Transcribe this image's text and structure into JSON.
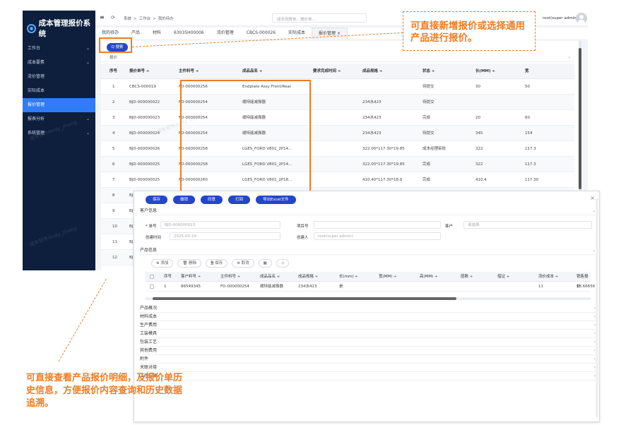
{
  "app": {
    "title": "成本管理报价系统"
  },
  "sidebar": {
    "items": [
      {
        "label": "工作台",
        "has_children": true
      },
      {
        "label": "成本要素",
        "has_children": true
      },
      {
        "label": "流价管理",
        "has_children": false
      },
      {
        "label": "实际成本",
        "has_children": false
      },
      {
        "label": "报价管理",
        "has_children": false,
        "active": true
      },
      {
        "label": "报表分析",
        "has_children": true
      },
      {
        "label": "系统管理",
        "has_children": true
      }
    ]
  },
  "topbar": {
    "menu_icon": "≡",
    "refresh_icon": "⟳",
    "breadcrumb": [
      "系统",
      ">",
      "工作台",
      ">",
      "我的待办"
    ],
    "search_placeholder": "成本测算单、报价单...",
    "user": "root(super admin)"
  },
  "tabs": [
    "我的待办",
    "产品",
    "材料",
    "63035H00006",
    "流价管理",
    "CBCS-000026",
    "实际成本",
    "报价管理 ×"
  ],
  "list": {
    "search_button": "Q 搜索",
    "section_label": "报价",
    "headers": [
      "序号",
      "报价单号 ÷",
      "主件料号 ÷",
      "成品品名 ÷",
      "要求完成时间 ÷",
      "成品规格 ÷",
      "状态 ÷",
      "长(MM) ÷",
      "宽"
    ],
    "rows": [
      [
        "1",
        "CBCS-000019",
        "FD-000000256",
        "Endplate Assy Front/Rear",
        "",
        "",
        "待提交",
        "30",
        "50"
      ],
      [
        "2",
        "BJD-000000022",
        "FD-000000254",
        "缓特能减振器",
        "",
        "234水423",
        "待提交",
        "",
        ""
      ],
      [
        "3",
        "BJD-000000023",
        "FD-000000254",
        "缓特能减振器",
        "",
        "234水423",
        "完成",
        "20",
        "60"
      ],
      [
        "4",
        "BJD-000000024",
        "FD-000000254",
        "缓特能减振器",
        "",
        "234水423",
        "待提交",
        "345",
        "154"
      ],
      [
        "5",
        "BJD-000000026",
        "FD-000000258",
        "LGES_FORD V801_2P14...",
        "",
        "322.00*117.30*19.85",
        "成本经理审批",
        "322",
        "117.3"
      ],
      [
        "6",
        "BJD-000000025",
        "FD-000000258",
        "LGES_FORD V801_2P14...",
        "",
        "322.00*117.30*19.85",
        "完成",
        "322",
        "117.3"
      ],
      [
        "7",
        "BJD-000000025",
        "FD-000000260",
        "LGES_FORD V801_2P18...",
        "",
        "410.40*117.30*18.9",
        "完成",
        "410.4",
        "117.30"
      ],
      [
        "8",
        "BJ",
        "",
        "",
        "",
        "",
        "",
        "",
        ""
      ],
      [
        "9",
        "BJ",
        "",
        "",
        "",
        "",
        "",
        "",
        ""
      ],
      [
        "10",
        "BJ",
        "",
        "",
        "",
        "",
        "",
        "",
        ""
      ],
      [
        "11",
        "BJ",
        "",
        "",
        "",
        "",
        "",
        "",
        ""
      ],
      [
        "12",
        "BJ",
        "",
        "",
        "",
        "",
        "",
        "",
        ""
      ]
    ]
  },
  "modal": {
    "buttons": [
      "保存",
      "撤销",
      "同意",
      "打回",
      "导出Excel文件"
    ],
    "section_customer": "客户信息",
    "fields": {
      "order_label": "* 单号",
      "order_value": "BJD-000000023",
      "project_label": "项目号",
      "customer_label": "客户",
      "customer_placeholder": "请选择",
      "created_time_label": "创建时间",
      "created_time_value": "2025-03-19",
      "creator_label": "创建人",
      "creator_value": "root(super admin)"
    },
    "section_product": "产品信息",
    "product_toolbar": [
      "⊕ 添加",
      "🗑 删除",
      "🗎 保存",
      "⊗ 取消",
      "▦",
      "⊹"
    ],
    "product_headers": [
      "",
      "序号",
      "客户料号 ÷",
      "主件料号 ÷",
      "成品品名 ÷",
      "成品规格 ÷",
      "长(mm) ÷",
      "宽(MM) ÷",
      "高(MM) ÷",
      "层数 ÷",
      "借证 ÷",
      "流价成本 ÷",
      "销售报价"
    ],
    "product_row": [
      "",
      "1",
      "86549345",
      "FD-000000254",
      "缓特能减振器",
      "234水423",
      "是",
      "",
      "",
      "",
      "",
      "11",
      "18.66656"
    ],
    "collapsed_sections": [
      "产品概况",
      "材料成本",
      "生产费用",
      "工装模具",
      "包装工艺",
      "其他费用",
      "附件",
      "关联对接",
      "工作记录"
    ]
  },
  "callouts": {
    "top": "可直接新增报价或选择通用产品进行报价。",
    "bottom": "可直接查看产品报价明细，及报价单历史信息，方便报价内容查询和历史数据追溯。"
  },
  "colors": {
    "sidebar": "#0d1f3c",
    "active": "#2f7cf6",
    "primary_button": "#2446c9",
    "annotation": "#f07b22"
  }
}
